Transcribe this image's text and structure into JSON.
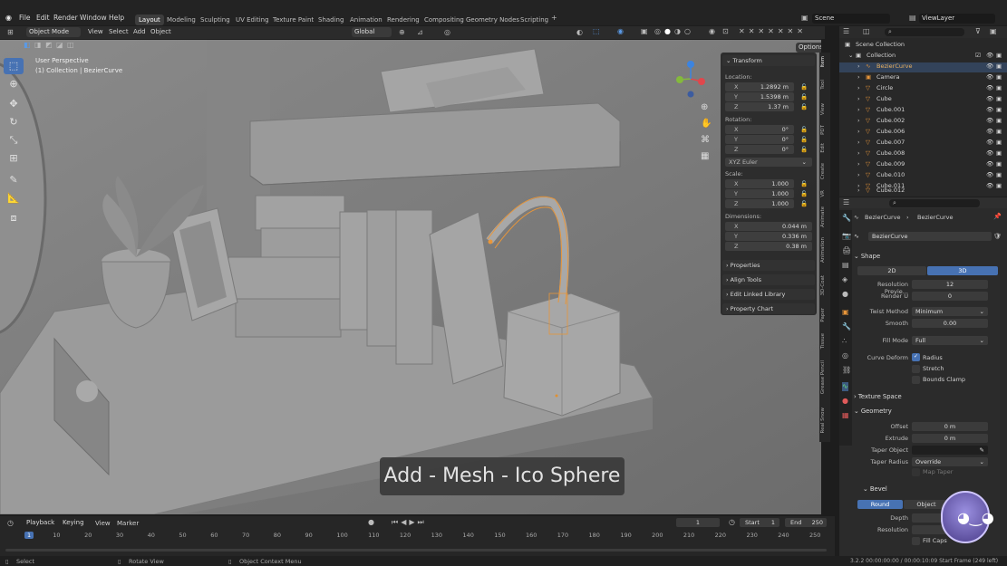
{
  "menu": {
    "items": [
      "File",
      "Edit",
      "Render",
      "Window",
      "Help"
    ],
    "workspaces": [
      "Layout",
      "Modeling",
      "Sculpting",
      "UV Editing",
      "Texture Paint",
      "Shading",
      "Animation",
      "Rendering",
      "Compositing",
      "Geometry Nodes",
      "Scripting"
    ],
    "active_workspace": "Layout",
    "add_tab_icon": "plus-icon",
    "scene_label": "Scene",
    "viewlayer_label": "ViewLayer"
  },
  "viewport_header": {
    "mode": "Object Mode",
    "menus": [
      "View",
      "Select",
      "Add",
      "Object"
    ],
    "orientation": "Global",
    "options_label": "Options"
  },
  "viewport": {
    "perspective_label": "User Perspective",
    "collection_label": "(1) Collection | BezierCurve",
    "toast": "Add - Mesh - Ico Sphere",
    "gizmo_colors": {
      "x": "#e0474c",
      "y": "#84b93c",
      "z": "#3c84e0"
    }
  },
  "npanel": {
    "transform_header": "Transform",
    "location_label": "Location:",
    "location": [
      {
        "axis": "X",
        "value": "1.2892 m"
      },
      {
        "axis": "Y",
        "value": "1.5398 m"
      },
      {
        "axis": "Z",
        "value": "1.37 m"
      }
    ],
    "rotation_label": "Rotation:",
    "rotation": [
      {
        "axis": "X",
        "value": "0°"
      },
      {
        "axis": "Y",
        "value": "0°"
      },
      {
        "axis": "Z",
        "value": "0°"
      }
    ],
    "rotation_mode": "XYZ Euler",
    "scale_label": "Scale:",
    "scale": [
      {
        "axis": "X",
        "value": "1.000"
      },
      {
        "axis": "Y",
        "value": "1.000"
      },
      {
        "axis": "Z",
        "value": "1.000"
      }
    ],
    "dimensions_label": "Dimensions:",
    "dimensions": [
      {
        "axis": "X",
        "value": "0.044 m"
      },
      {
        "axis": "Y",
        "value": "0.336 m"
      },
      {
        "axis": "Z",
        "value": "0.38 m"
      }
    ],
    "sections": [
      "Properties",
      "Align Tools",
      "Edit Linked Library",
      "Property Chart"
    ],
    "tabs": [
      "Item",
      "Tool",
      "View",
      "PDT",
      "Edit",
      "Create",
      "VR",
      "Animate",
      "Animation",
      "3D-Coat",
      "Paper",
      "Tissue",
      "Grease Pencil",
      "Real Snow"
    ]
  },
  "outliner": {
    "root": "Scene Collection",
    "collection": "Collection",
    "items": [
      "BezierCurve",
      "Camera",
      "Circle",
      "Cube",
      "Cube.001",
      "Cube.002",
      "Cube.006",
      "Cube.007",
      "Cube.008",
      "Cube.009",
      "Cube.010",
      "Cube.011",
      "Cube.012"
    ],
    "active_item": "BezierCurve"
  },
  "properties": {
    "breadcrumb_object": "BezierCurve",
    "breadcrumb_data": "BezierCurve",
    "datablock_name": "BezierCurve",
    "shape_header": "Shape",
    "dim_2d": "2D",
    "dim_3d": "3D",
    "resolution_preview_label": "Resolution Previe...",
    "resolution_preview": "12",
    "render_u_label": "Render U",
    "render_u": "0",
    "twist_method_label": "Twist Method",
    "twist_method": "Minimum",
    "smooth_label": "Smooth",
    "smooth": "0.00",
    "fill_mode_label": "Fill Mode",
    "fill_mode": "Full",
    "curve_deform_label": "Curve Deform",
    "radius_label": "Radius",
    "stretch_label": "Stretch",
    "bounds_clamp_label": "Bounds Clamp",
    "texture_space_header": "Texture Space",
    "geometry_header": "Geometry",
    "offset_label": "Offset",
    "offset": "0 m",
    "extrude_label": "Extrude",
    "extrude": "0 m",
    "taper_object_label": "Taper Object",
    "taper_radius_label": "Taper Radius",
    "taper_radius": "Override",
    "map_taper_label": "Map Taper",
    "bevel_header": "Bevel",
    "bevel_round": "Round",
    "bevel_object": "Object",
    "depth_label": "Depth",
    "resolution_label": "Resolution",
    "fill_caps_label": "Fill Caps"
  },
  "timeline": {
    "menus": [
      "Playback",
      "Keying",
      "View",
      "Marker"
    ],
    "current_frame": "1",
    "start_label": "Start",
    "start": "1",
    "end_label": "End",
    "end": "250",
    "ticks": [
      "1",
      "10",
      "20",
      "30",
      "40",
      "50",
      "60",
      "70",
      "80",
      "90",
      "100",
      "110",
      "120",
      "130",
      "140",
      "150",
      "160",
      "170",
      "180",
      "190",
      "200",
      "210",
      "220",
      "230",
      "240",
      "250"
    ]
  },
  "status": {
    "select": "Select",
    "rotate_view": "Rotate View",
    "context_menu": "Object Context Menu",
    "right_info": "3.2.2   00:00:00:00 / 00:00:10:09   Start Frame (249 left)"
  }
}
